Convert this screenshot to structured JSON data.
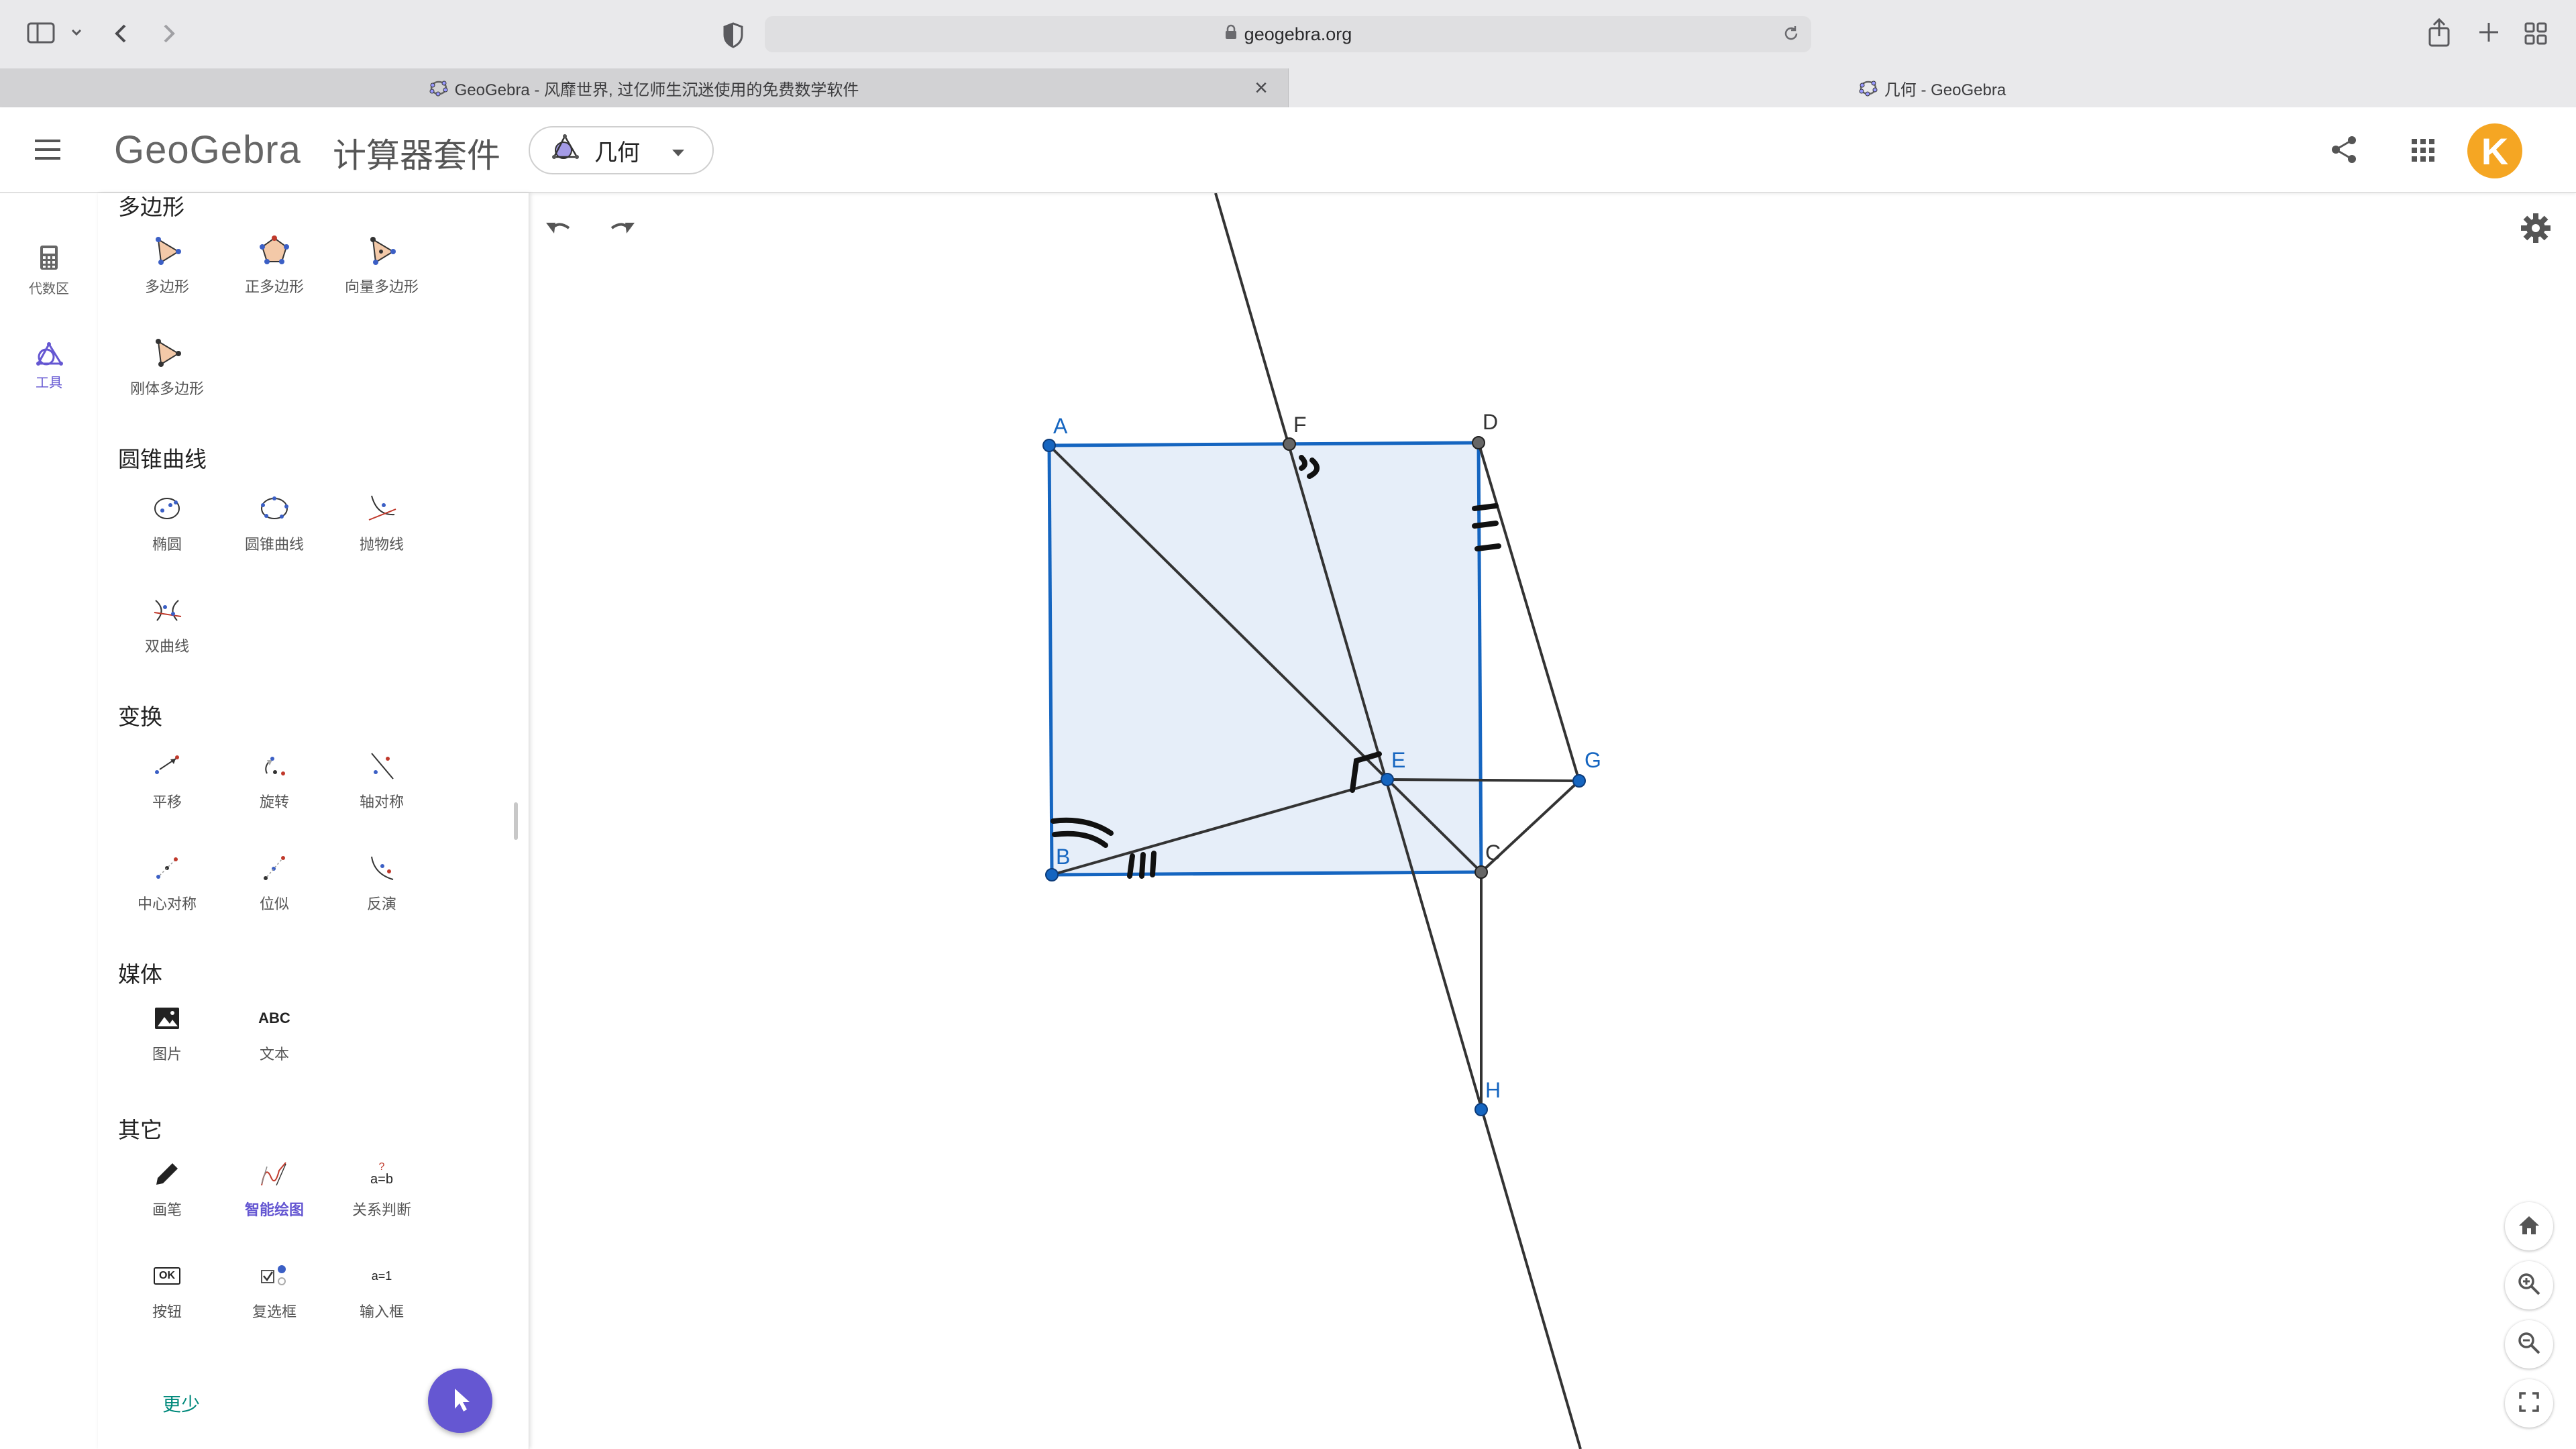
{
  "browser": {
    "url": "geogebra.org",
    "tabs": [
      {
        "title": "GeoGebra - 风靡世界, 过亿师生沉迷使用的免费数学软件",
        "close": "×"
      },
      {
        "title": "几何 - GeoGebra"
      }
    ]
  },
  "header": {
    "brand": "GeoGebra",
    "suite": "计算器套件",
    "app": "几何",
    "avatar_letter": "K",
    "accent": "#6557d2",
    "avatar_color": "#f5a623"
  },
  "rail": {
    "items": [
      {
        "label": "代数区",
        "icon": "calculator-icon"
      },
      {
        "label": "工具",
        "icon": "geometry-icon"
      }
    ]
  },
  "tools": {
    "sections": {
      "polygon": {
        "title": "多边形",
        "items": [
          "多边形",
          "正多边形",
          "向量多边形",
          "刚体多边形"
        ]
      },
      "conics": {
        "title": "圆锥曲线",
        "items": [
          "椭圆",
          "圆锥曲线",
          "抛物线",
          "双曲线"
        ]
      },
      "transform": {
        "title": "变换",
        "items": [
          "平移",
          "旋转",
          "轴对称",
          "中心对称",
          "位似",
          "反演"
        ]
      },
      "media": {
        "title": "媒体",
        "items": [
          "图片",
          "文本"
        ],
        "abc": "ABC"
      },
      "other": {
        "title": "其它",
        "items": [
          "画笔",
          "智能绘图",
          "关系判断",
          "按钮",
          "复选框",
          "输入框"
        ],
        "ok": "OK",
        "relation": "a=b",
        "relation_q": "?",
        "input_glyph": "a=1"
      }
    },
    "more_label": "更少"
  },
  "graphics": {
    "points": [
      "A",
      "B",
      "C",
      "D",
      "E",
      "F",
      "G",
      "H"
    ],
    "fill_color": "#e6eef9",
    "outline_color": "#1565c0"
  }
}
